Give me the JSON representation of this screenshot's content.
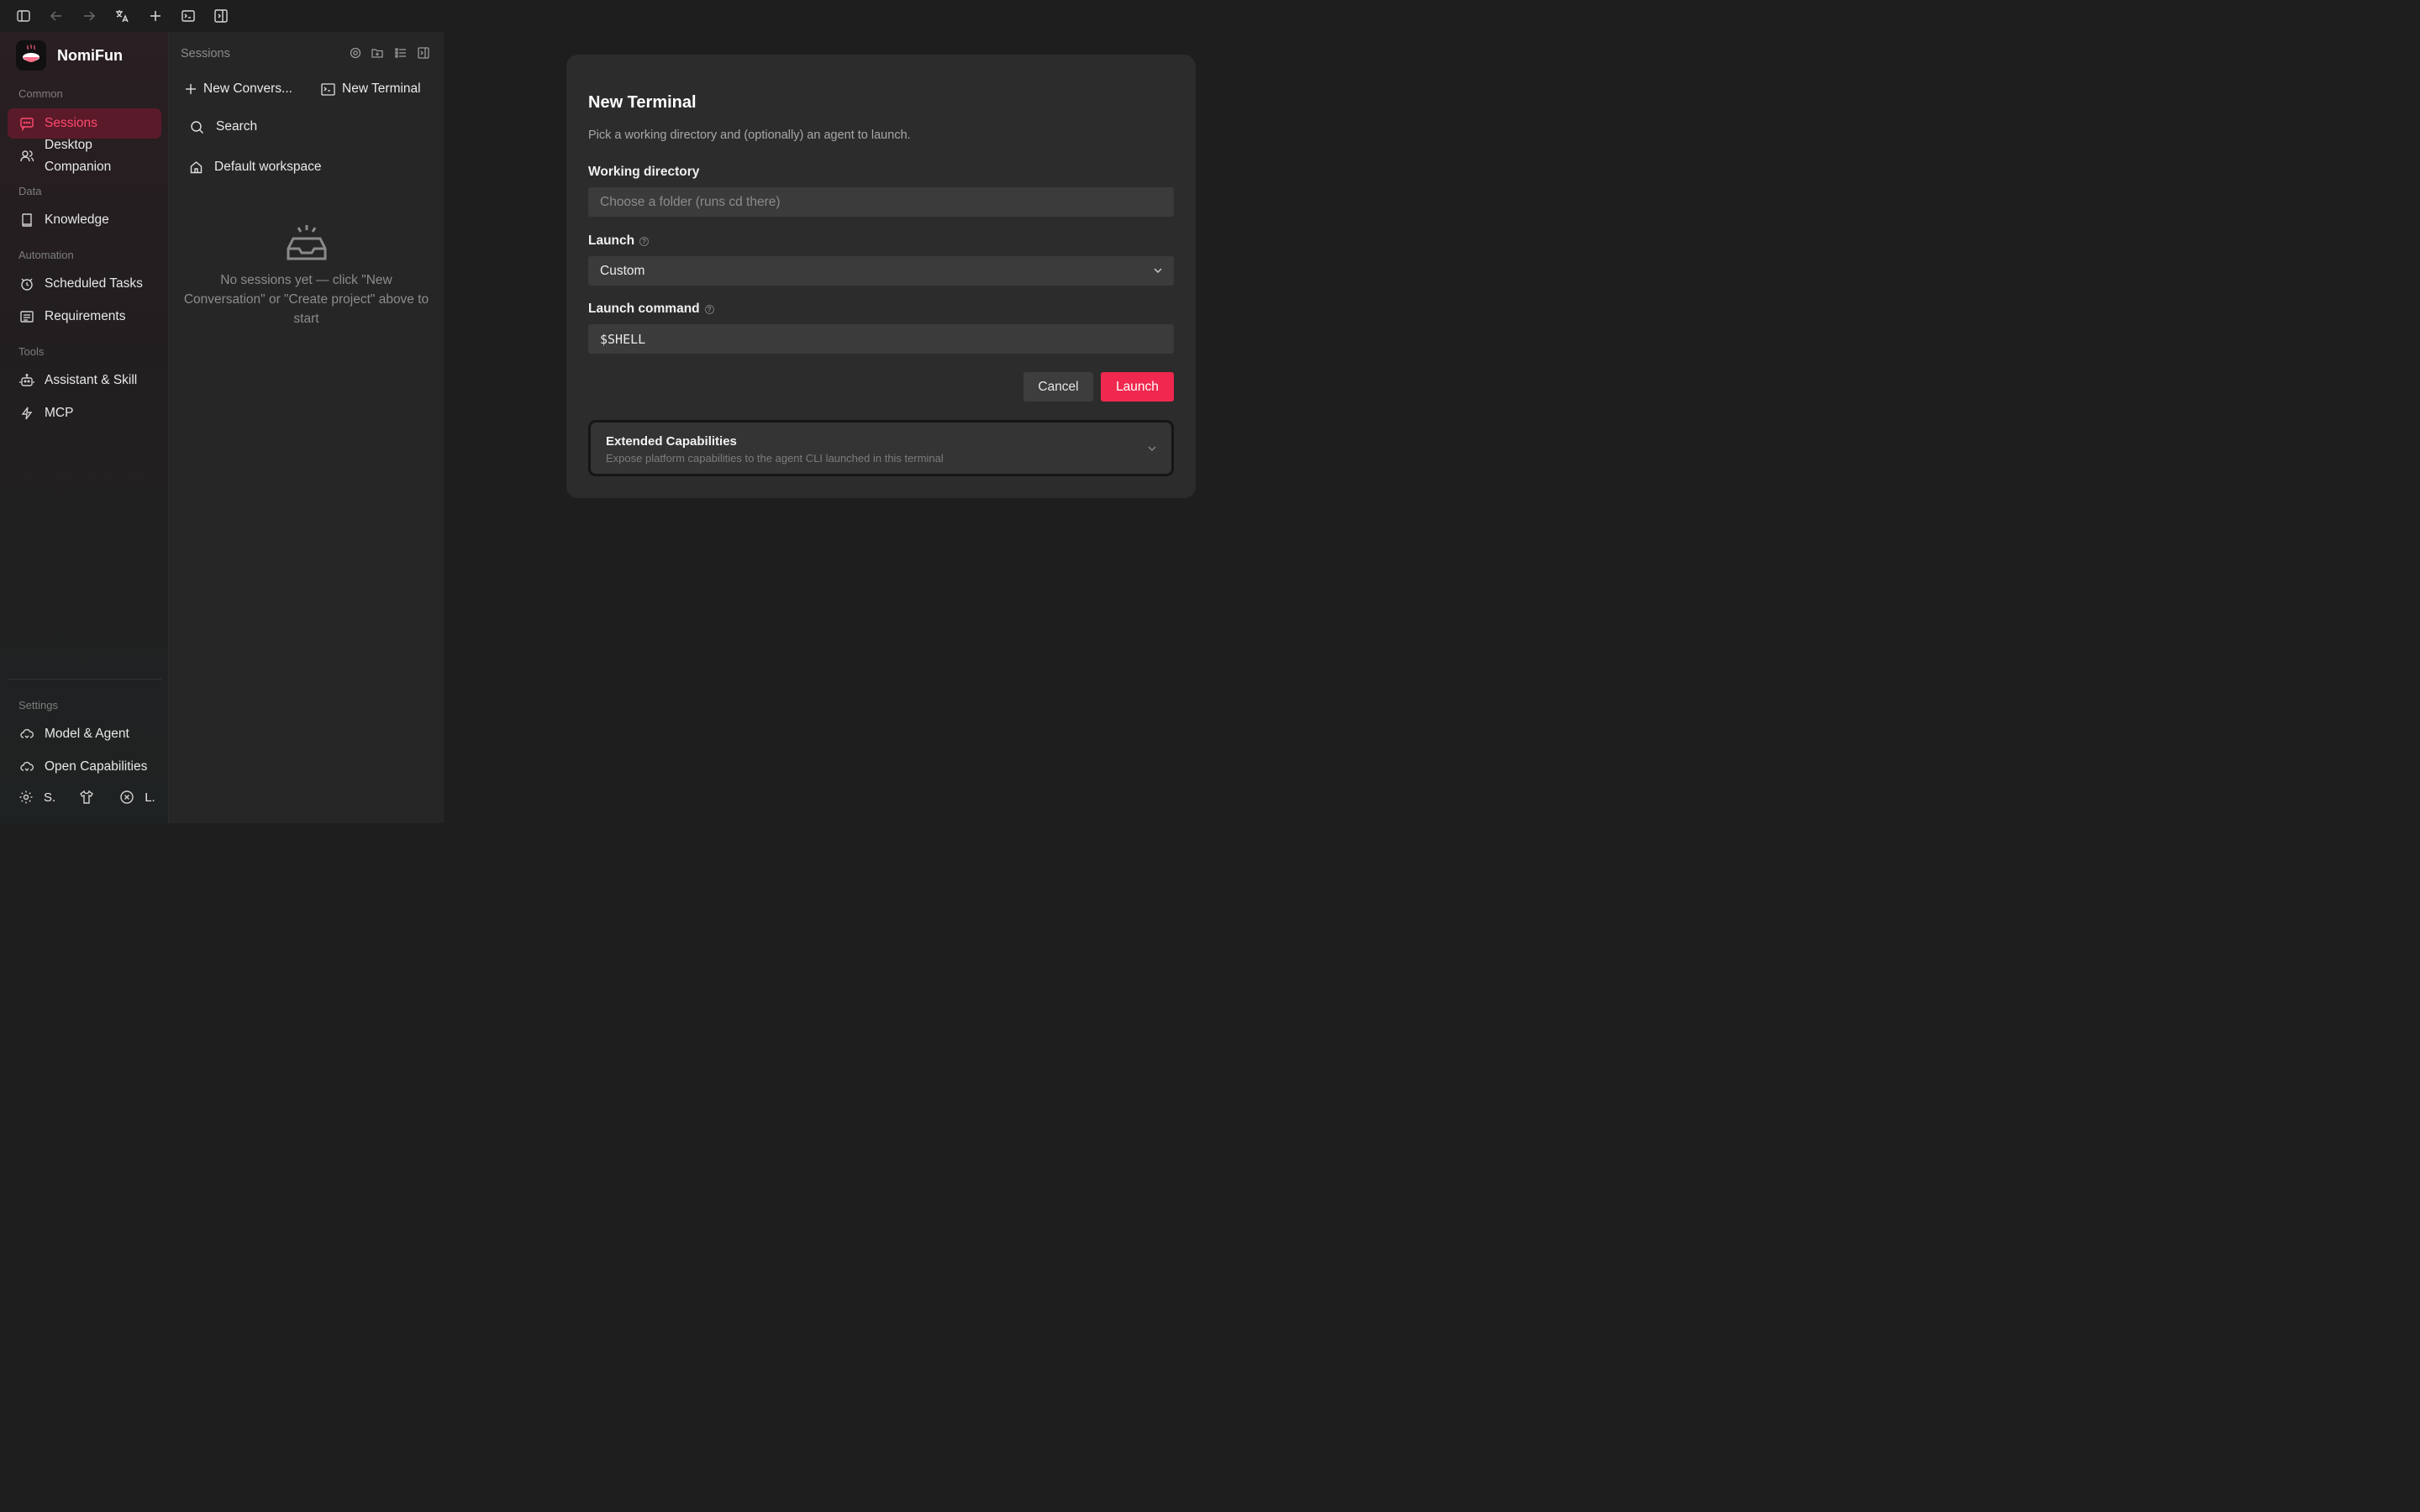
{
  "toolbar": {
    "icons": [
      "sidebar-toggle-icon",
      "back-arrow-icon",
      "forward-arrow-icon",
      "translate-icon",
      "plus-icon",
      "terminal-icon",
      "panel-right-icon"
    ]
  },
  "brand": {
    "name": "NomiFun"
  },
  "sidebar": {
    "sections": {
      "common": "Common",
      "data": "Data",
      "automation": "Automation",
      "tools": "Tools",
      "settings": "Settings"
    },
    "items": {
      "sessions": "Sessions",
      "desktop_companion_1": "Desktop",
      "desktop_companion_2": "Companion",
      "knowledge": "Knowledge",
      "scheduled_tasks": "Scheduled Tasks",
      "requirements": "Requirements",
      "assistant_skill": "Assistant & Skill",
      "mcp": "MCP",
      "model_agent": "Model & Agent",
      "open_capabilities": "Open Capabilities"
    },
    "bottom": {
      "settings_short": "S.",
      "logout_short": "L."
    }
  },
  "sessions": {
    "title": "Sessions",
    "new_conversation": "New Convers...",
    "new_terminal": "New Terminal",
    "search": "Search",
    "default_workspace": "Default workspace",
    "empty_line1": "No sessions yet — click \"New",
    "empty_line2": "Conversation\" or \"Create project\" above to",
    "empty_line3": "start"
  },
  "dialog": {
    "title": "New Terminal",
    "subtitle": "Pick a working directory and (optionally) an agent to launch.",
    "working_dir_label": "Working directory",
    "working_dir_placeholder": "Choose a folder (runs cd there)",
    "launch_label": "Launch",
    "launch_value": "Custom",
    "launch_command_label": "Launch command",
    "launch_command_value": "$SHELL",
    "cancel": "Cancel",
    "launch": "Launch",
    "ext_title": "Extended Capabilities",
    "ext_subtitle": "Expose platform capabilities to the agent CLI launched in this terminal"
  },
  "colors": {
    "accent": "#f0284f",
    "active_bg": "#5a1a2a",
    "active_text": "#ff4a6e"
  }
}
